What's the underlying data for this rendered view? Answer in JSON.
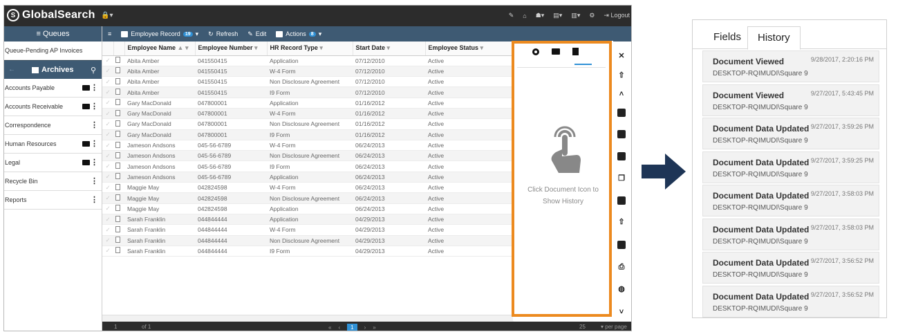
{
  "app": {
    "name": "GlobalSearch",
    "topbar_icons": [
      "✎",
      "⌂",
      "♟▾",
      "▤▾",
      "▥▾",
      "⚙",
      "↦ Logout"
    ],
    "logout_label": "Logout"
  },
  "sidebar": {
    "queues_label": "≡ Queues",
    "queue_item": "Queue-Pending AP Invoices",
    "archives_label": "Archives",
    "archives": [
      {
        "label": "Accounts Payable",
        "folder": true
      },
      {
        "label": "Accounts Receivable",
        "folder": true
      },
      {
        "label": "Correspondence",
        "folder": false
      },
      {
        "label": "Human Resources",
        "folder": true
      },
      {
        "label": "Legal",
        "folder": true
      },
      {
        "label": "Recycle Bin",
        "folder": false
      },
      {
        "label": "Reports",
        "folder": false
      }
    ]
  },
  "toolbar": {
    "menu_label": "≡",
    "employee_record": "Employee Record",
    "employee_record_count": "19",
    "refresh": "Refresh",
    "edit": "Edit",
    "actions": "Actions",
    "actions_count": "8"
  },
  "grid": {
    "columns": [
      "Employee Name",
      "Employee Number",
      "HR Record Type",
      "Start Date",
      "Employee Status"
    ],
    "rows": [
      [
        "Abita Amber",
        "041550415",
        "Application",
        "07/12/2010",
        "Active"
      ],
      [
        "Abita Amber",
        "041550415",
        "W-4 Form",
        "07/12/2010",
        "Active"
      ],
      [
        "Abita Amber",
        "041550415",
        "Non Disclosure Agreement",
        "07/12/2010",
        "Active"
      ],
      [
        "Abita Amber",
        "041550415",
        "I9 Form",
        "07/12/2010",
        "Active"
      ],
      [
        "Gary MacDonald",
        "047800001",
        "Application",
        "01/16/2012",
        "Active"
      ],
      [
        "Gary MacDonald",
        "047800001",
        "W-4 Form",
        "01/16/2012",
        "Active"
      ],
      [
        "Gary MacDonald",
        "047800001",
        "Non Disclosure Agreement",
        "01/16/2012",
        "Active"
      ],
      [
        "Gary MacDonald",
        "047800001",
        "I9 Form",
        "01/16/2012",
        "Active"
      ],
      [
        "Jameson Andsons",
        "045-56-6789",
        "W-4 Form",
        "06/24/2013",
        "Active"
      ],
      [
        "Jameson Andsons",
        "045-56-6789",
        "Non Disclosure Agreement",
        "06/24/2013",
        "Active"
      ],
      [
        "Jameson Andsons",
        "045-56-6789",
        "I9 Form",
        "06/24/2013",
        "Active"
      ],
      [
        "Jameson Andsons",
        "045-56-6789",
        "Application",
        "06/24/2013",
        "Active"
      ],
      [
        "Maggie May",
        "042824598",
        "W-4 Form",
        "06/24/2013",
        "Active"
      ],
      [
        "Maggie May",
        "042824598",
        "Non Disclosure Agreement",
        "06/24/2013",
        "Active"
      ],
      [
        "Maggie May",
        "042824598",
        "Application",
        "06/24/2013",
        "Active"
      ],
      [
        "Sarah Franklin",
        "044844444",
        "Application",
        "04/29/2013",
        "Active"
      ],
      [
        "Sarah Franklin",
        "044844444",
        "W-4 Form",
        "04/29/2013",
        "Active"
      ],
      [
        "Sarah Franklin",
        "044844444",
        "Non Disclosure Agreement",
        "04/29/2013",
        "Active"
      ],
      [
        "Sarah Franklin",
        "044844444",
        "I9 Form",
        "04/29/2013",
        "Active"
      ]
    ]
  },
  "pager": {
    "page": "1",
    "of": "of 1",
    "current": "1",
    "per_page_count": "25",
    "per_page_label": "▾ per page"
  },
  "docpanel": {
    "hint": "Click Document Icon to Show History",
    "highlight_color": "#ec8a1f"
  },
  "history_panel": {
    "tabs": [
      "Fields",
      "History"
    ],
    "active_tab": "History",
    "entries": [
      {
        "title": "Document Viewed",
        "date": "9/28/2017, 2:20:16 PM",
        "source": "DESKTOP-RQIMUDI\\Square 9"
      },
      {
        "title": "Document Viewed",
        "date": "9/27/2017, 5:43:45 PM",
        "source": "DESKTOP-RQIMUDI\\Square 9"
      },
      {
        "title": "Document Data Updated",
        "date": "9/27/2017, 3:59:26 PM",
        "source": "DESKTOP-RQIMUDI\\Square 9"
      },
      {
        "title": "Document Data Updated",
        "date": "9/27/2017, 3:59:25 PM",
        "source": "DESKTOP-RQIMUDI\\Square 9"
      },
      {
        "title": "Document Data Updated",
        "date": "9/27/2017, 3:58:03 PM",
        "source": "DESKTOP-RQIMUDI\\Square 9"
      },
      {
        "title": "Document Data Updated",
        "date": "9/27/2017, 3:58:03 PM",
        "source": "DESKTOP-RQIMUDI\\Square 9"
      },
      {
        "title": "Document Data Updated",
        "date": "9/27/2017, 3:56:52 PM",
        "source": "DESKTOP-RQIMUDI\\Square 9"
      },
      {
        "title": "Document Data Updated",
        "date": "9/27/2017, 3:56:52 PM",
        "source": "DESKTOP-RQIMUDI\\Square 9"
      }
    ]
  },
  "colors": {
    "accent_bar": "#3e5a73",
    "arrow": "#1e3556",
    "pager_active": "#2f91d6"
  }
}
